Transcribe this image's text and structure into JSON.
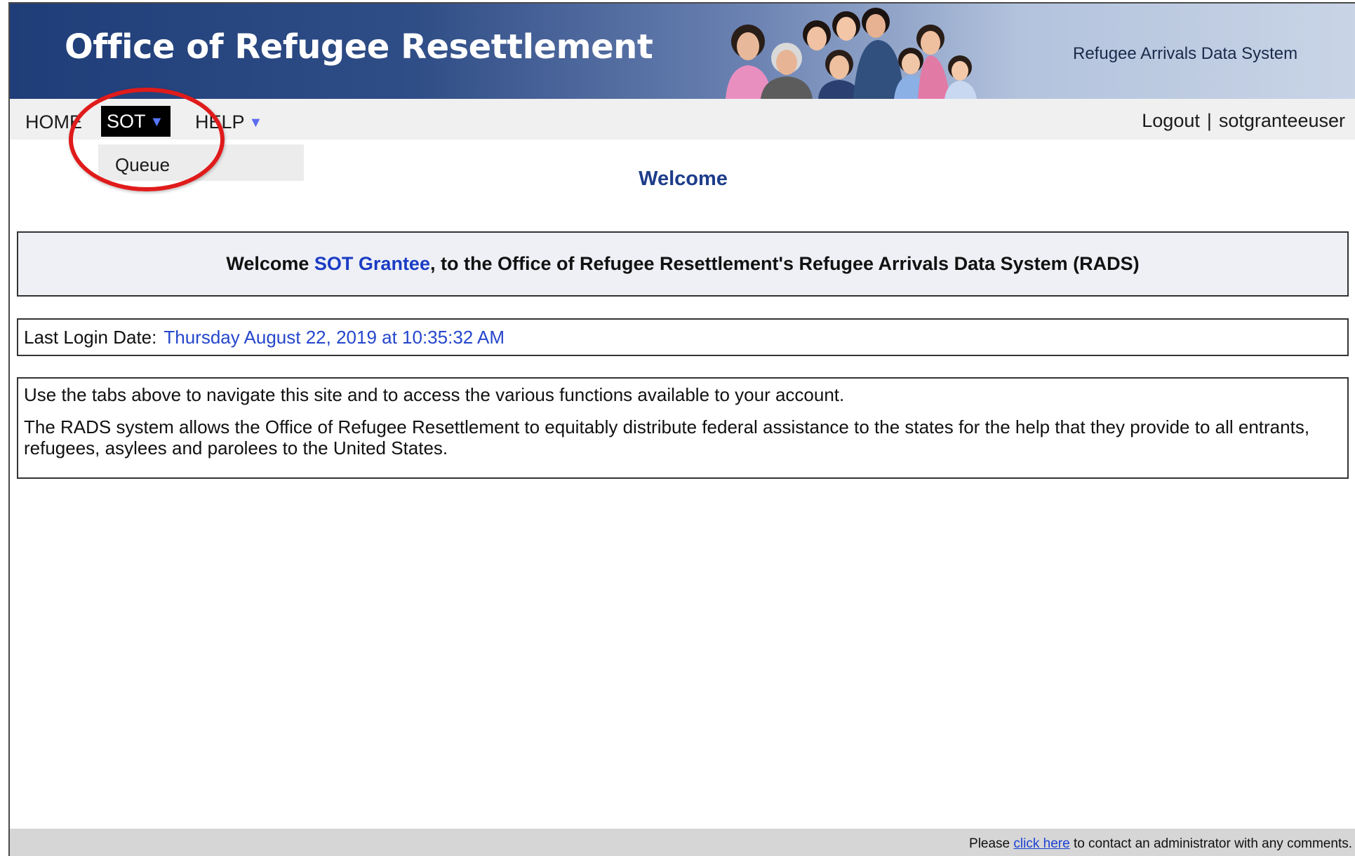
{
  "header": {
    "title": "Office of Refugee Resettlement",
    "subtitle": "Refugee Arrivals Data System"
  },
  "nav": {
    "items": [
      {
        "label": "HOME"
      },
      {
        "label": "SOT",
        "caret": "▼"
      },
      {
        "label": "HELP",
        "caret": "▼"
      }
    ],
    "logout": "Logout",
    "separator": "|",
    "username": "sotgranteeuser"
  },
  "dropdown": {
    "items": [
      {
        "label": "Queue"
      }
    ]
  },
  "page": {
    "heading": "Welcome",
    "welcome": {
      "prefix": "Welcome",
      "role": "SOT Grantee",
      "suffix": ", to the Office of Refugee Resettlement's Refugee Arrivals Data System (RADS)"
    },
    "last_login": {
      "label": "Last Login Date:",
      "value": "Thursday August 22, 2019 at 10:35:32 AM"
    },
    "info": [
      "Use the tabs above to navigate this site and to access the various functions available to your account.",
      "The RADS system allows the Office of Refugee Resettlement to equitably distribute federal assistance to the states for the help that they provide to all entrants, refugees, asylees and parolees to the United States."
    ]
  },
  "footer": {
    "prefix": "Please",
    "link": "click here",
    "suffix": "to contact an administrator with any comments."
  },
  "colors": {
    "banner_dark": "#1f3d78",
    "accent_blue": "#1d3d8a",
    "highlight_red": "#e01b1b"
  },
  "icons": {
    "dropdown_caret": "caret-down-icon",
    "banner_photo": "family-group-photo"
  }
}
